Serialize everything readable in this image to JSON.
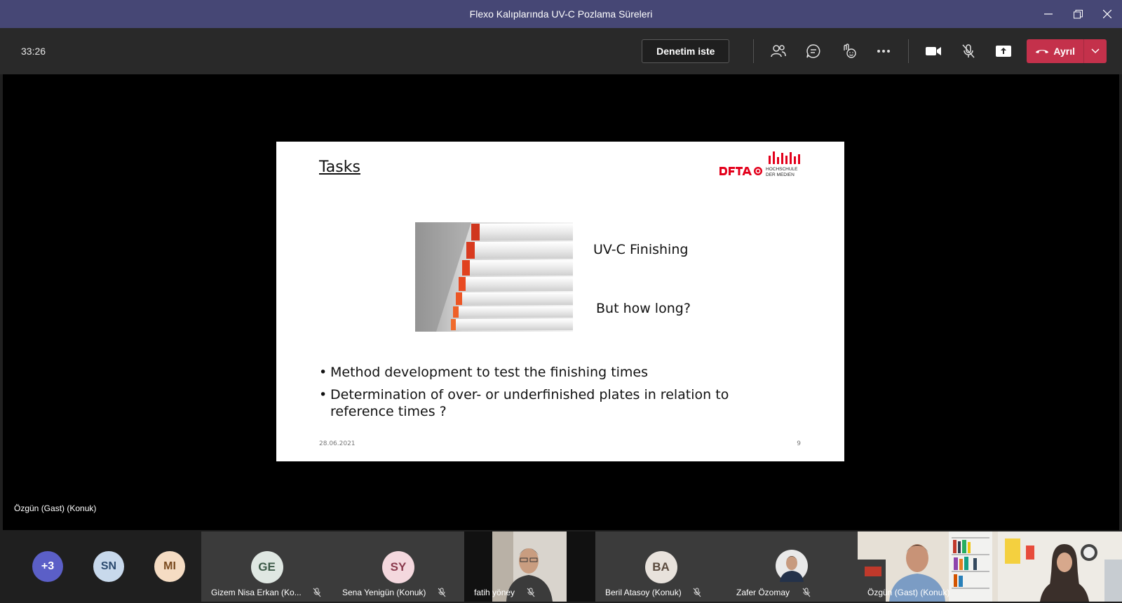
{
  "window": {
    "title": "Flexo Kalıplarında UV-C Pozlama Süreleri"
  },
  "toolbar": {
    "timer": "33:26",
    "admit_label": "Denetim iste",
    "leave_label": "Ayrıl"
  },
  "slide": {
    "title": "Tasks",
    "logo_text": "DFTA HOCHSCHULE DER MEDIEN",
    "line1": "UV-C Finishing",
    "line2": "But how long?",
    "bullets": [
      "Method development to test the finishing times",
      "Determination of over- or underfinished plates in relation to reference times ?"
    ],
    "date": "28.06.2021",
    "page": "9"
  },
  "presenter_label": "Özgün (Gast) (Konuk)",
  "participants": {
    "overflow": "+3",
    "avatars": [
      {
        "initials": "SN",
        "color": "#c8d9ec"
      },
      {
        "initials": "MI",
        "color": "#f5dcc3"
      }
    ],
    "tiles": [
      {
        "initials": "GE",
        "name": "Gizem Nisa Erkan (Ko...",
        "color": "#dfe7e2"
      },
      {
        "initials": "SY",
        "name": "Sena Yenigün (Konuk)",
        "color": "#f4d8de"
      },
      {
        "name": "fatih yöney"
      },
      {
        "initials": "BA",
        "name": "Beril Atasoy (Konuk)",
        "color": "#e8e2dc"
      },
      {
        "name": "Zafer Özomay"
      },
      {
        "name": "Özgün (Gast) (Konuk)"
      }
    ]
  },
  "colors": {
    "titlebar": "#464775",
    "leave": "#c4314b",
    "overflow_avatar": "#5b5fc7"
  }
}
